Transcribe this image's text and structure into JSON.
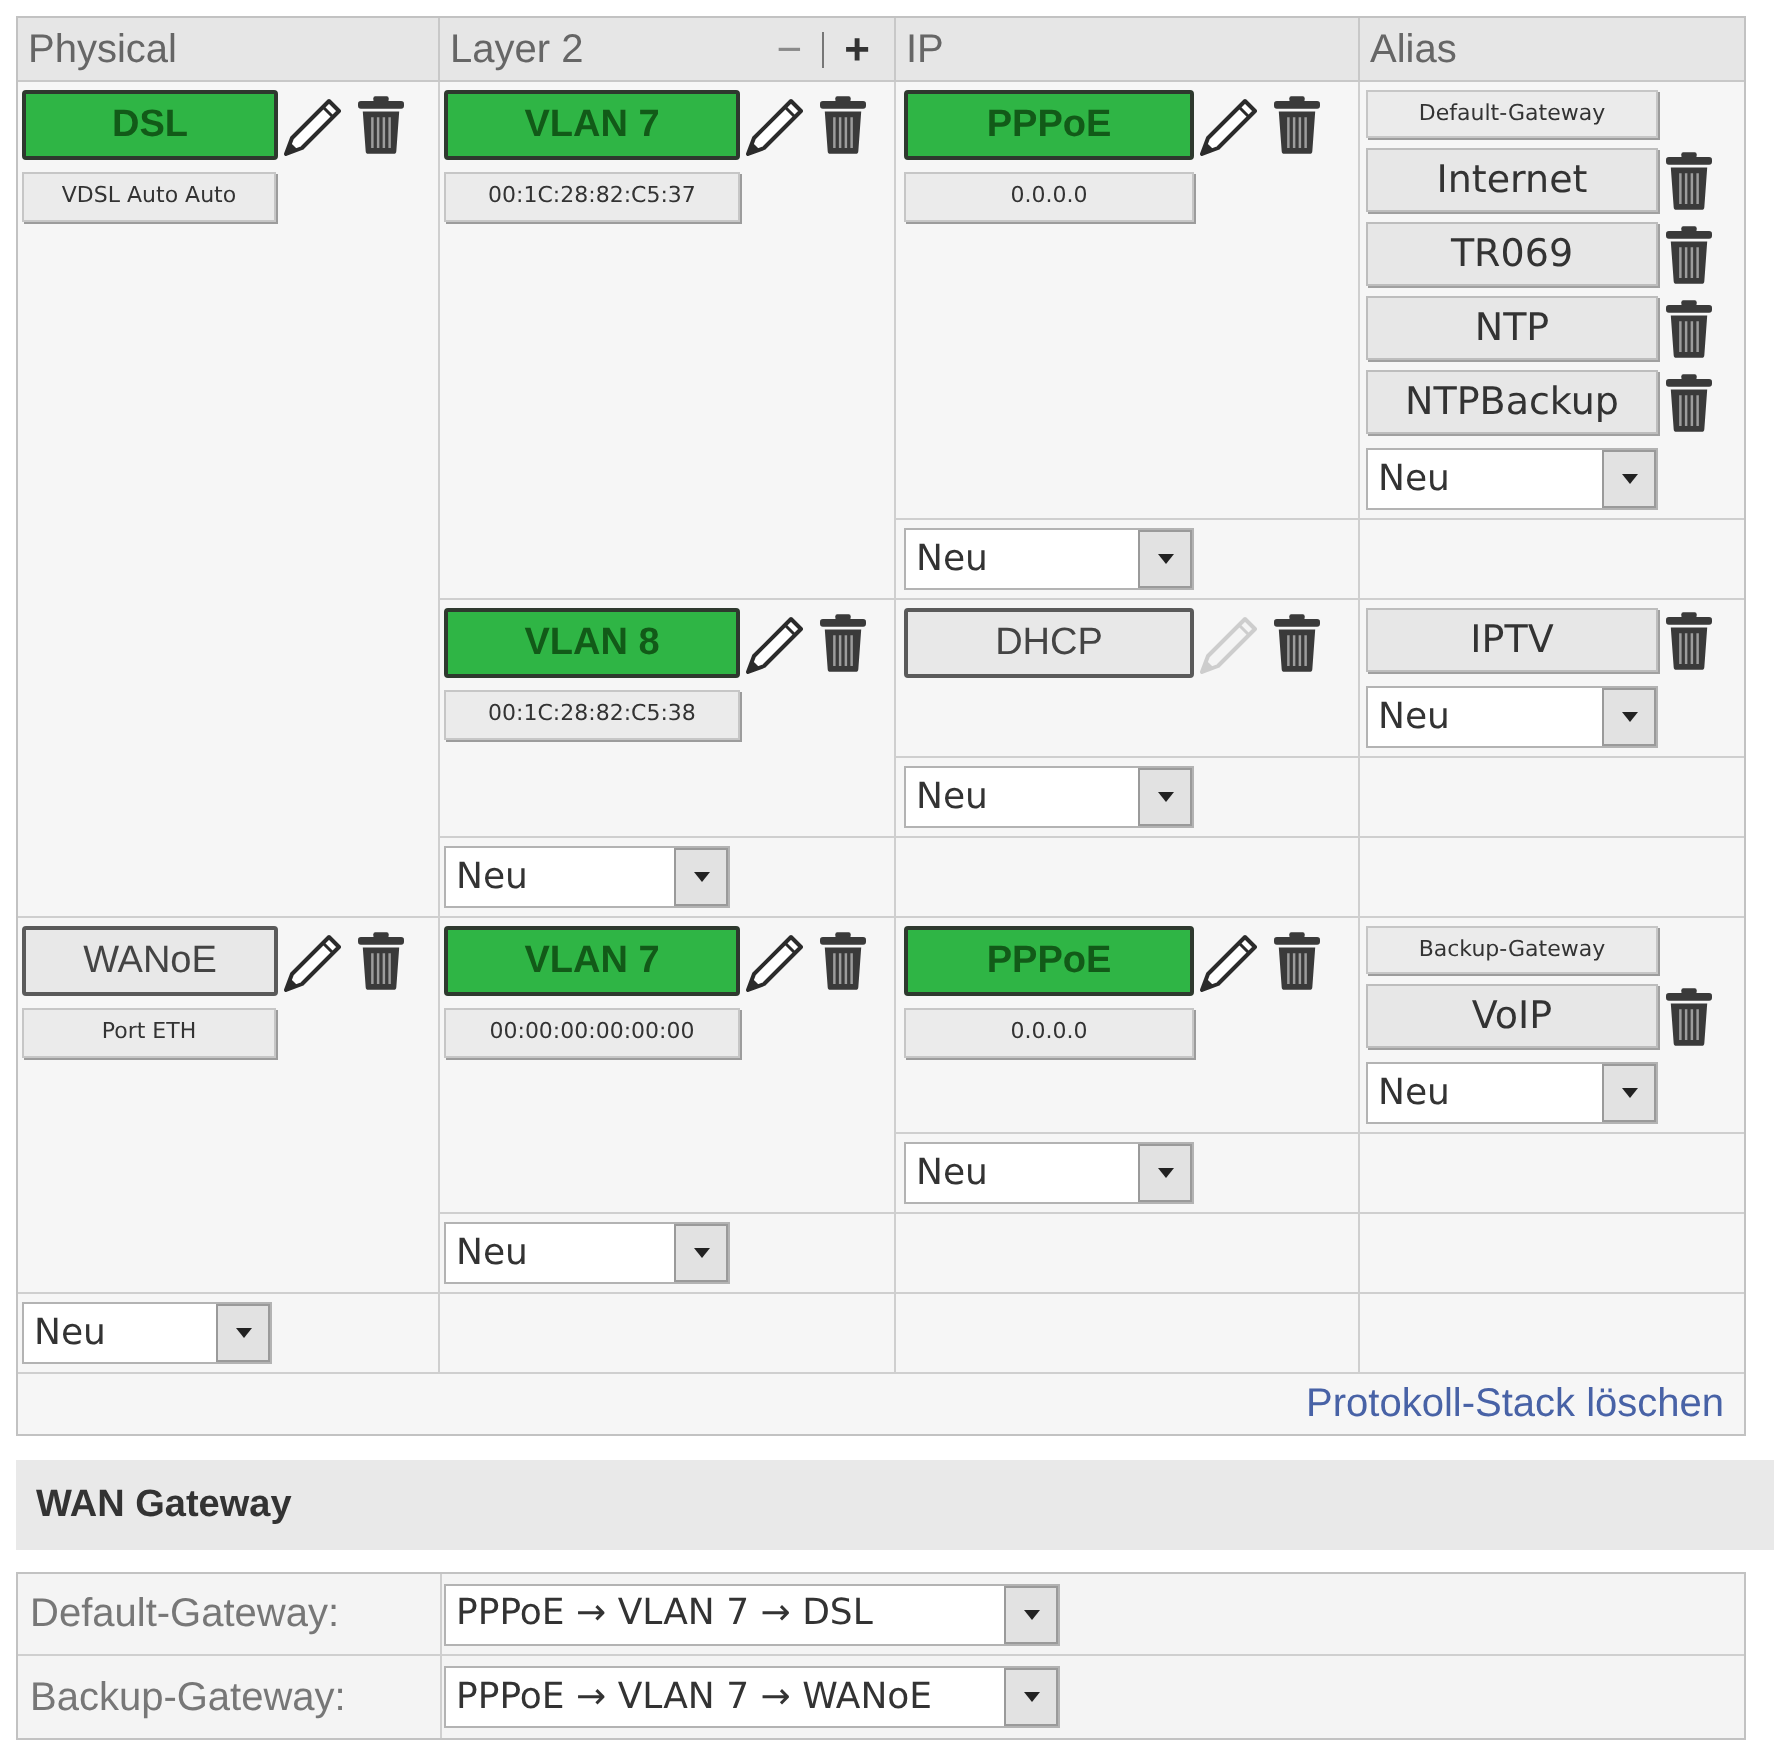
{
  "table": {
    "columns": [
      {
        "label": "Physical"
      },
      {
        "label": "Layer 2",
        "controls": [
          {
            "symbol": "−",
            "enabled": false
          },
          {
            "symbol": "+",
            "enabled": true
          }
        ]
      },
      {
        "label": "IP"
      },
      {
        "label": "Alias"
      }
    ],
    "rows": [
      {
        "name": "DSL",
        "active": true,
        "edit_enabled": true,
        "detail": "VDSL Auto Auto",
        "children": [
          {
            "name": "VLAN 7",
            "active": true,
            "edit_enabled": true,
            "detail": "00:1C:28:82:C5:37",
            "children": [
              {
                "name": "PPPoE",
                "active": true,
                "edit_enabled": true,
                "detail": "0.0.0.0",
                "gateway": "Default-Gateway",
                "aliases": [
                  {
                    "name": "Internet"
                  },
                  {
                    "name": "TR069"
                  },
                  {
                    "name": "NTP"
                  },
                  {
                    "name": "NTPBackup"
                  }
                ],
                "new_select": "Neu"
              }
            ],
            "new_select": "Neu"
          },
          {
            "name": "VLAN 8",
            "active": true,
            "edit_enabled": true,
            "detail": "00:1C:28:82:C5:38",
            "children": [
              {
                "name": "DHCP",
                "active": false,
                "edit_enabled": false,
                "aliases": [
                  {
                    "name": "IPTV"
                  }
                ],
                "new_select": "Neu"
              }
            ],
            "new_select": "Neu"
          }
        ],
        "new_select": "Neu"
      },
      {
        "name": "WANoE",
        "active": false,
        "edit_enabled": true,
        "detail": "Port ETH",
        "children": [
          {
            "name": "VLAN 7",
            "active": true,
            "edit_enabled": true,
            "detail": "00:00:00:00:00:00",
            "children": [
              {
                "name": "PPPoE",
                "active": true,
                "edit_enabled": true,
                "detail": "0.0.0.0",
                "gateway": "Backup-Gateway",
                "aliases": [
                  {
                    "name": "VoIP"
                  }
                ],
                "new_select": "Neu"
              }
            ],
            "new_select": "Neu"
          }
        ],
        "new_select": "Neu"
      }
    ],
    "new_select": "Neu",
    "footer_link": "Protokoll-Stack löschen"
  },
  "wan_gateway": {
    "title": "WAN Gateway",
    "rows": [
      {
        "label": "Default-Gateway:",
        "value": "PPPoE → VLAN 7 → DSL"
      },
      {
        "label": "Backup-Gateway:",
        "value": "PPPoE → VLAN 7 → WANoE"
      }
    ]
  }
}
